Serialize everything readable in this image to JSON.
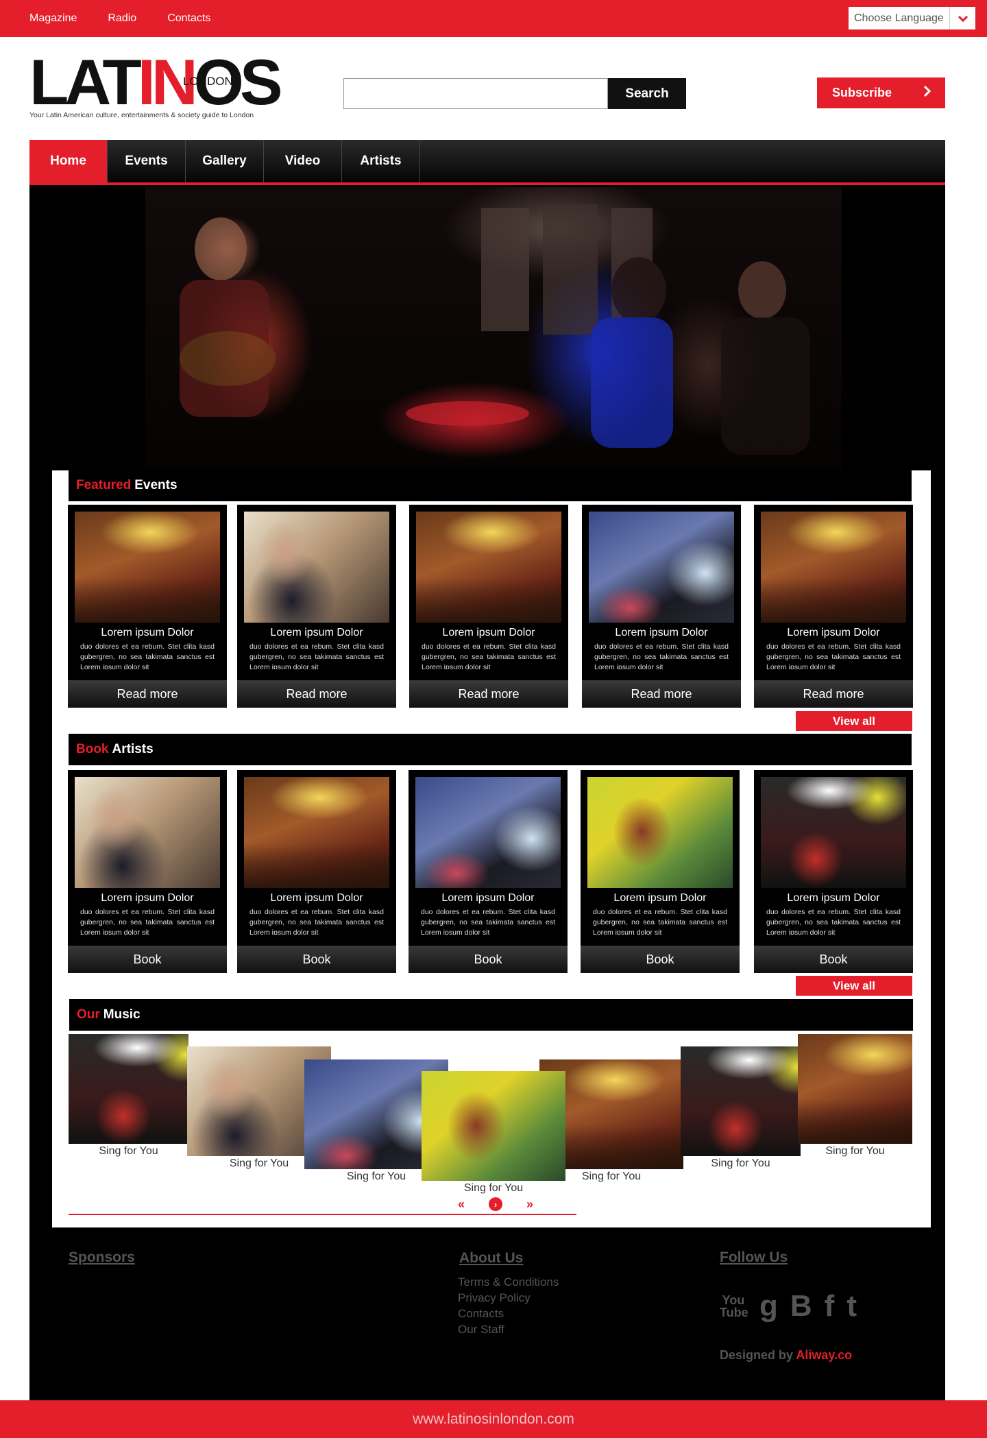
{
  "topbar": {
    "links": [
      "Magazine",
      "Radio",
      "Contacts"
    ],
    "language_label": "Choose Language"
  },
  "logo": {
    "part1": "LAT",
    "part2": "IN",
    "part3": "OS",
    "sub": "LONDON",
    "tagline": "Your Latin American culture, entertainments & society guide to London"
  },
  "search": {
    "placeholder": "",
    "button_label": "Search"
  },
  "subscribe_label": "Subscribe",
  "mainnav": [
    {
      "label": "Home",
      "active": true
    },
    {
      "label": "Events",
      "active": false
    },
    {
      "label": "Gallery",
      "active": false
    },
    {
      "label": "Video",
      "active": false
    },
    {
      "label": "Artists",
      "active": false
    }
  ],
  "featured": {
    "title_red": "Featured",
    "title_white": "Events",
    "cards": [
      {
        "image": "wiltons",
        "title": "Lorem ipsum Dolor",
        "desc": "duo dolores et ea rebum. Stet clita kasd gubergren, no sea takimata sanctus est Lorem ipsum dolor sit",
        "button": "Read more"
      },
      {
        "image": "flute",
        "title": "Lorem ipsum Dolor",
        "desc": "duo dolores et ea rebum. Stet clita kasd gubergren, no sea takimata sanctus est Lorem ipsum dolor sit",
        "button": "Read more"
      },
      {
        "image": "wiltons",
        "title": "Lorem ipsum Dolor",
        "desc": "duo dolores et ea rebum. Stet clita kasd gubergren, no sea takimata sanctus est Lorem ipsum dolor sit",
        "button": "Read more"
      },
      {
        "image": "guitar",
        "title": "Lorem ipsum Dolor",
        "desc": "duo dolores et ea rebum. Stet clita kasd gubergren, no sea takimata sanctus est Lorem ipsum dolor sit",
        "button": "Read more"
      },
      {
        "image": "wiltons",
        "title": "Lorem ipsum Dolor",
        "desc": "duo dolores et ea rebum. Stet clita kasd gubergren, no sea takimata sanctus est Lorem ipsum dolor sit",
        "button": "Read more"
      }
    ],
    "view_all": "View all"
  },
  "artists": {
    "title_red": "Book",
    "title_white": "Artists",
    "cards": [
      {
        "image": "flute",
        "title": "Lorem ipsum Dolor",
        "desc": "duo dolores et ea rebum. Stet clita kasd gubergren, no sea takimata sanctus est Lorem ipsum dolor sit",
        "button": "Book"
      },
      {
        "image": "wiltons",
        "title": "Lorem ipsum Dolor",
        "desc": "duo dolores et ea rebum. Stet clita kasd gubergren, no sea takimata sanctus est Lorem ipsum dolor sit",
        "button": "Book"
      },
      {
        "image": "guitar",
        "title": "Lorem ipsum Dolor",
        "desc": "duo dolores et ea rebum. Stet clita kasd gubergren, no sea takimata sanctus est Lorem ipsum dolor sit",
        "button": "Book"
      },
      {
        "image": "friday",
        "title": "Lorem ipsum Dolor",
        "desc": "duo dolores et ea rebum. Stet clita kasd gubergren, no sea takimata sanctus est Lorem ipsum dolor sit",
        "button": "Book"
      },
      {
        "image": "chiva",
        "title": "Lorem ipsum Dolor",
        "desc": "duo dolores et ea rebum. Stet clita kasd gubergren, no sea takimata sanctus est Lorem ipsum dolor sit",
        "button": "Book"
      }
    ],
    "view_all": "View all"
  },
  "music": {
    "title_red": "Our",
    "title_white": "Music",
    "items": [
      {
        "image": "chiva",
        "label": "Sing for You"
      },
      {
        "image": "flute",
        "label": "Sing for You"
      },
      {
        "image": "guitar",
        "label": "Sing for You"
      },
      {
        "image": "friday",
        "label": "Sing for You"
      },
      {
        "image": "wiltons",
        "label": "Sing for You"
      },
      {
        "image": "chiva",
        "label": "Sing for You"
      },
      {
        "image": "wiltons",
        "label": "Sing for You"
      }
    ],
    "prev_symbol": "«",
    "next_symbol": "»",
    "current_symbol": "›"
  },
  "footer": {
    "sponsors_title": "Sponsors",
    "about_title": "About Us",
    "about_links": [
      "Terms & Conditions",
      "Privacy Policy",
      "Contacts",
      "Our Staff"
    ],
    "follow_title": "Follow Us",
    "social": [
      {
        "name": "youtube-icon",
        "glyph": "You Tube"
      },
      {
        "name": "google-icon",
        "glyph": "g"
      },
      {
        "name": "blogger-icon",
        "glyph": "B"
      },
      {
        "name": "facebook-icon",
        "glyph": "f"
      },
      {
        "name": "twitter-icon",
        "glyph": "t"
      }
    ],
    "designed_by": "Designed by",
    "designer": "Aliway.co",
    "url": "www.latinosinlondon.com"
  },
  "colors": {
    "accent": "#e41e2a",
    "dark": "#000000"
  }
}
